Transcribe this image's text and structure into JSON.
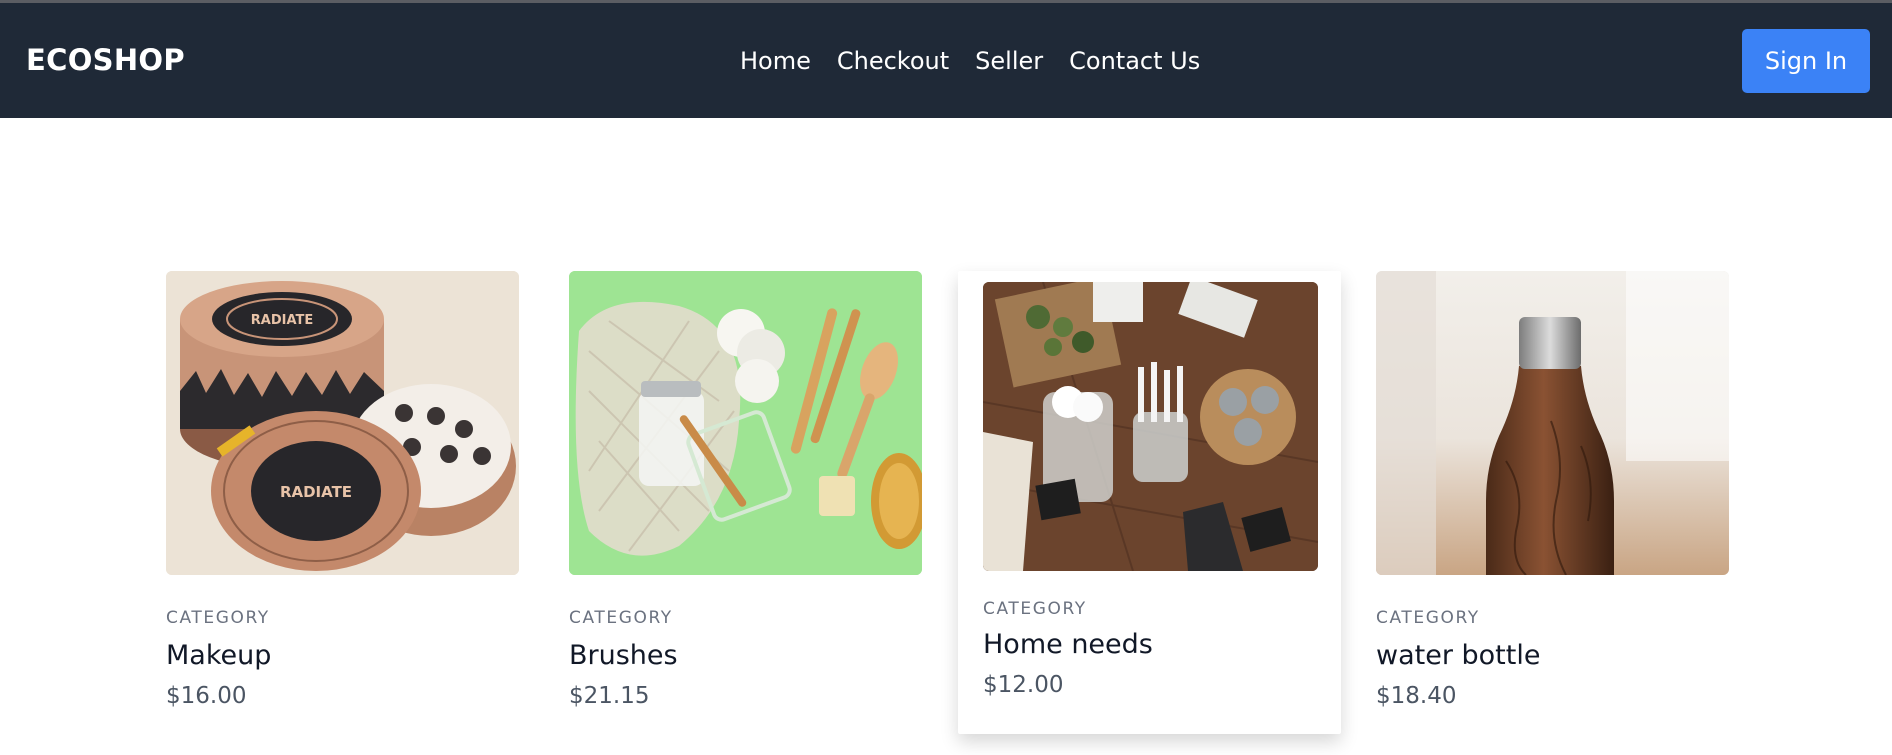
{
  "nav": {
    "brand": "ECOSHOP",
    "links": [
      "Home",
      "Checkout",
      "Seller",
      "Contact Us"
    ],
    "signin": "Sign In"
  },
  "colors": {
    "navbar": "#1f2937",
    "accent": "#3b82f6"
  },
  "products": [
    {
      "category": "CATEGORY",
      "name": "Makeup",
      "price": "$16.00",
      "image": "candle-tins-photo"
    },
    {
      "category": "CATEGORY",
      "name": "Brushes",
      "price": "$21.15",
      "image": "eco-brushes-photo"
    },
    {
      "category": "CATEGORY",
      "name": "Home needs",
      "price": "$12.00",
      "image": "home-store-photo"
    },
    {
      "category": "CATEGORY",
      "name": "water bottle",
      "price": "$18.40",
      "image": "wood-bottle-photo"
    }
  ]
}
